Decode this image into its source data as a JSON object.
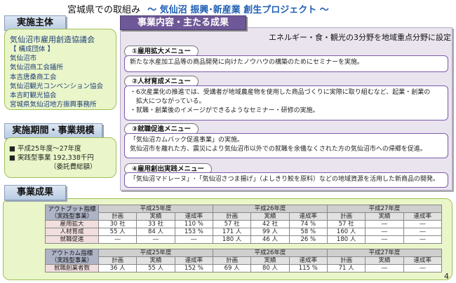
{
  "title": {
    "main": "宮城県での取組み",
    "sub": "～ 気仙沼 振興･新産業 創生プロジェクト ～"
  },
  "implementer": {
    "label": "実施主体",
    "org": "気仙沼市雇用創造協議会",
    "members_title": "【 構成団体 】",
    "members": [
      "気仙沼市",
      "気仙沼商工会議所",
      "本吉唐桑商工会",
      "気仙沼観光コンベンション協会",
      "本吉町観光協会",
      "宮城県気仙沼地方振興事務所"
    ]
  },
  "period": {
    "label": "実施期間・事業規模",
    "lines": [
      "■ 平成25年度～27年度",
      "■ 実践型事業 192,338千円",
      "（委託費総額）"
    ]
  },
  "content": {
    "label": "事業内容・主たる成果",
    "tagline": "エネルギー・食・観光の3分野を地域重点分野に設定",
    "items": [
      {
        "title": "①雇用拡大メニュー",
        "lines": [
          "新たな水産加工品等の商品開発に向けたノウハウの構築のためにセミナーを実施。"
        ]
      },
      {
        "title": "②人材育成メニュー",
        "lines": [
          "・6次産業化の推進では、受講者が地域農産物を使用した商品づくりに実際に取り組むなど、起業・創業の",
          "　拡大につながっている。",
          "・就職・創業後のイメージができるようなセミナー・研修の実施。"
        ]
      },
      {
        "title": "③就職促進メニュー",
        "lines": [
          "「気仙沼カムバック促進事業」の実施。",
          "気仙沼市を離れた方、震災により気仙沼市以外での就職を余儀なくされた方の気仙沼市への帰郷を促進。"
        ]
      },
      {
        "title": "④雇用創出実践メニュー",
        "lines": [
          "「気仙沼マドレーヌ」･「気仙沼さつま揚げ」（よしきり鮫を原料）などの地域資源を活用した新商品の開発。"
        ]
      }
    ]
  },
  "results": {
    "label": "事業成果",
    "years": [
      "平成25年度",
      "平成26年度",
      "平成27年度"
    ],
    "sub_cols": [
      "計画",
      "実績",
      "達成率"
    ],
    "output": {
      "header_line1": "アウトプット指標",
      "header_line2": "（実践型事業）",
      "rows": [
        {
          "label": "雇用拡大",
          "cells": [
            "30 社",
            "33 社",
            "110 %",
            "57 社",
            "42 社",
            "74 %",
            "57 社",
            "―",
            "―"
          ]
        },
        {
          "label": "人材育成",
          "cells": [
            "55 人",
            "84 人",
            "153 %",
            "171 人",
            "99 人",
            "58 %",
            "160 人",
            "―",
            "―"
          ]
        },
        {
          "label": "就職促進",
          "cells": [
            "―",
            "―",
            "―",
            "180 人",
            "46 人",
            "26 %",
            "180 人",
            "―",
            "―"
          ]
        }
      ]
    },
    "outcome": {
      "header_line1": "アウトカム指標",
      "header_line2": "（実践型事業）",
      "rows": [
        {
          "label": "就職創業者数",
          "cells": [
            "36 人",
            "55 人",
            "152 %",
            "69 人",
            "80 人",
            "115 %",
            "71 人",
            "―",
            "―"
          ]
        }
      ]
    }
  },
  "page_number": "4"
}
